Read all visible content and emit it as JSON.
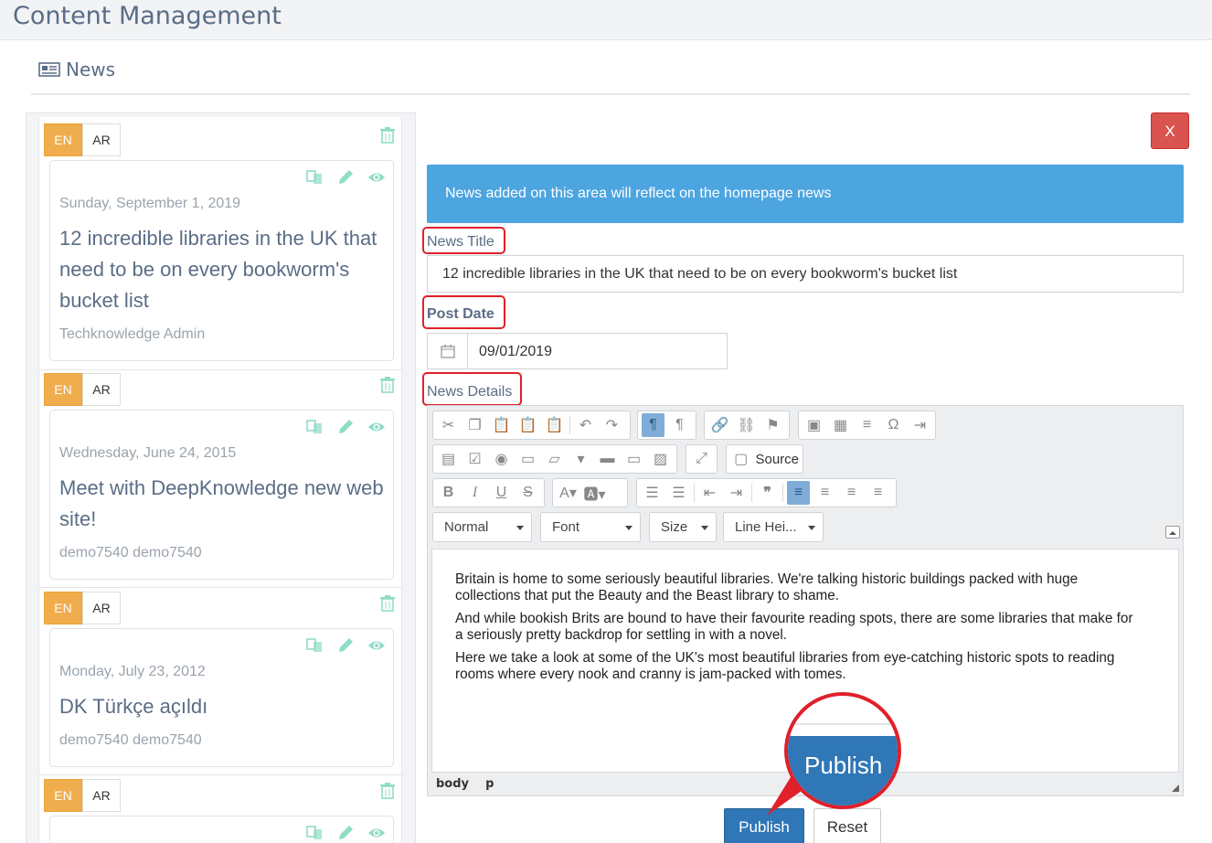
{
  "app": {
    "title": "Content Management"
  },
  "section": {
    "title": "News",
    "icon": "newspaper-icon"
  },
  "colors": {
    "accent": "#4da5e0",
    "lang_active": "#f0ad4e",
    "danger": "#d9534f",
    "primary": "#2f77b6",
    "highlight": "#e0202a"
  },
  "news_list": [
    {
      "lang_en": "EN",
      "lang_ar": "AR",
      "date": "Sunday, September 1, 2019",
      "title": "12 incredible libraries in the UK that need to be on every bookworm's bucket list",
      "author": "Techknowledge Admin"
    },
    {
      "lang_en": "EN",
      "lang_ar": "AR",
      "date": "Wednesday, June 24, 2015",
      "title": "Meet with DeepKnowledge new web site!",
      "author": "demo7540 demo7540"
    },
    {
      "lang_en": "EN",
      "lang_ar": "AR",
      "date": "Monday, July 23, 2012",
      "title": "DK Türkçe açıldı",
      "author": "demo7540 demo7540"
    },
    {
      "lang_en": "EN",
      "lang_ar": "AR"
    }
  ],
  "form": {
    "close_label": "X",
    "info": "News added on this area will reflect on the homepage news",
    "title_label": "News Title",
    "title_value": "12 incredible libraries in the UK that need to be on every bookworm's bucket list",
    "date_label": "Post Date",
    "date_value": "09/01/2019",
    "details_label": "News Details"
  },
  "editor": {
    "source_label": "Source",
    "format_select": "Normal",
    "font_select": "Font",
    "size_select": "Size",
    "lineheight_select": "Line Hei...",
    "paragraphs": [
      "Britain is home to some seriously beautiful libraries. We're talking historic buildings packed with huge collections that put the Beauty and the Beast library to shame.",
      "And while bookish Brits are bound to have their favourite reading spots, there are some libraries that make for a seriously pretty backdrop for settling in with a novel.",
      "Here we take a look at some of the UK's most beautiful libraries from eye-catching historic spots to reading rooms where every nook and cranny is jam-packed with tomes."
    ],
    "path_body": "body",
    "path_p": "p"
  },
  "actions": {
    "publish_label": "Publish",
    "reset_label": "Reset"
  },
  "callout": {
    "label": "Publish"
  }
}
